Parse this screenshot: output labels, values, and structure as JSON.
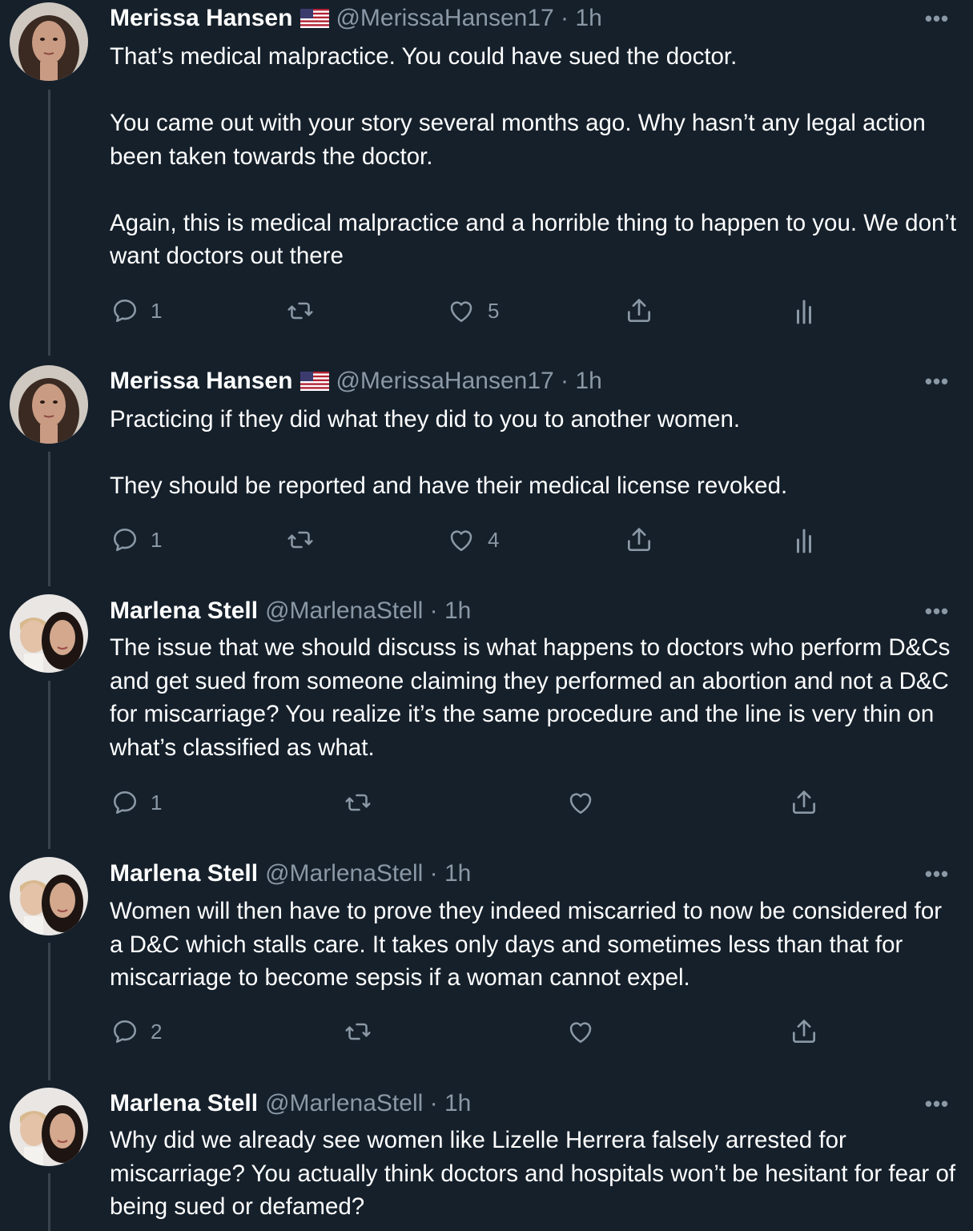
{
  "tweets": [
    {
      "name": "Merissa Hansen",
      "flag": true,
      "handle": "@MerissaHansen17",
      "time": "1h",
      "body": "That’s medical malpractice. You could have sued the doctor.\n\nYou came out with your story several months ago. Why hasn’t any legal action been taken towards the doctor.\n\nAgain, this is medical malpractice and a horrible thing to happen to you. We don’t want doctors out there",
      "replies": "1",
      "retweets": "",
      "likes": "5",
      "views": "",
      "more": "•••"
    },
    {
      "name": "Merissa Hansen",
      "flag": true,
      "handle": "@MerissaHansen17",
      "time": "1h",
      "body": "Practicing if they did what they did to you to another women.\n\nThey should be reported and have their medical license revoked.",
      "replies": "1",
      "retweets": "",
      "likes": "4",
      "views": "",
      "more": "•••"
    },
    {
      "name": "Marlena Stell",
      "flag": false,
      "handle": "@MarlenaStell",
      "time": "1h",
      "body": "The issue that we should discuss is what happens to doctors who perform D&Cs and get sued from someone claiming they performed an abortion and not a D&C for miscarriage? You realize it’s the same procedure and the line is very thin on what’s classified as what.",
      "replies": "1",
      "retweets": "",
      "likes": "",
      "more": "•••"
    },
    {
      "name": "Marlena Stell",
      "flag": false,
      "handle": "@MarlenaStell",
      "time": "1h",
      "body": "Women will then have to prove they indeed miscarried to now be considered for a D&C which stalls care. It takes only days and sometimes less than that for miscarriage to become sepsis if a woman cannot expel.",
      "replies": "2",
      "retweets": "",
      "likes": "",
      "more": "•••"
    },
    {
      "name": "Marlena Stell",
      "flag": false,
      "handle": "@MarlenaStell",
      "time": "1h",
      "body": "Why did we already see women like Lizelle Herrera falsely arrested for miscarriage? You actually think doctors and hospitals won’t be hesitant for fear of being sued or defamed?",
      "more": "•••"
    }
  ],
  "separator": "·",
  "colors": {
    "background": "#15202b",
    "muted": "#8b98a5",
    "thread_line": "#38444d"
  }
}
